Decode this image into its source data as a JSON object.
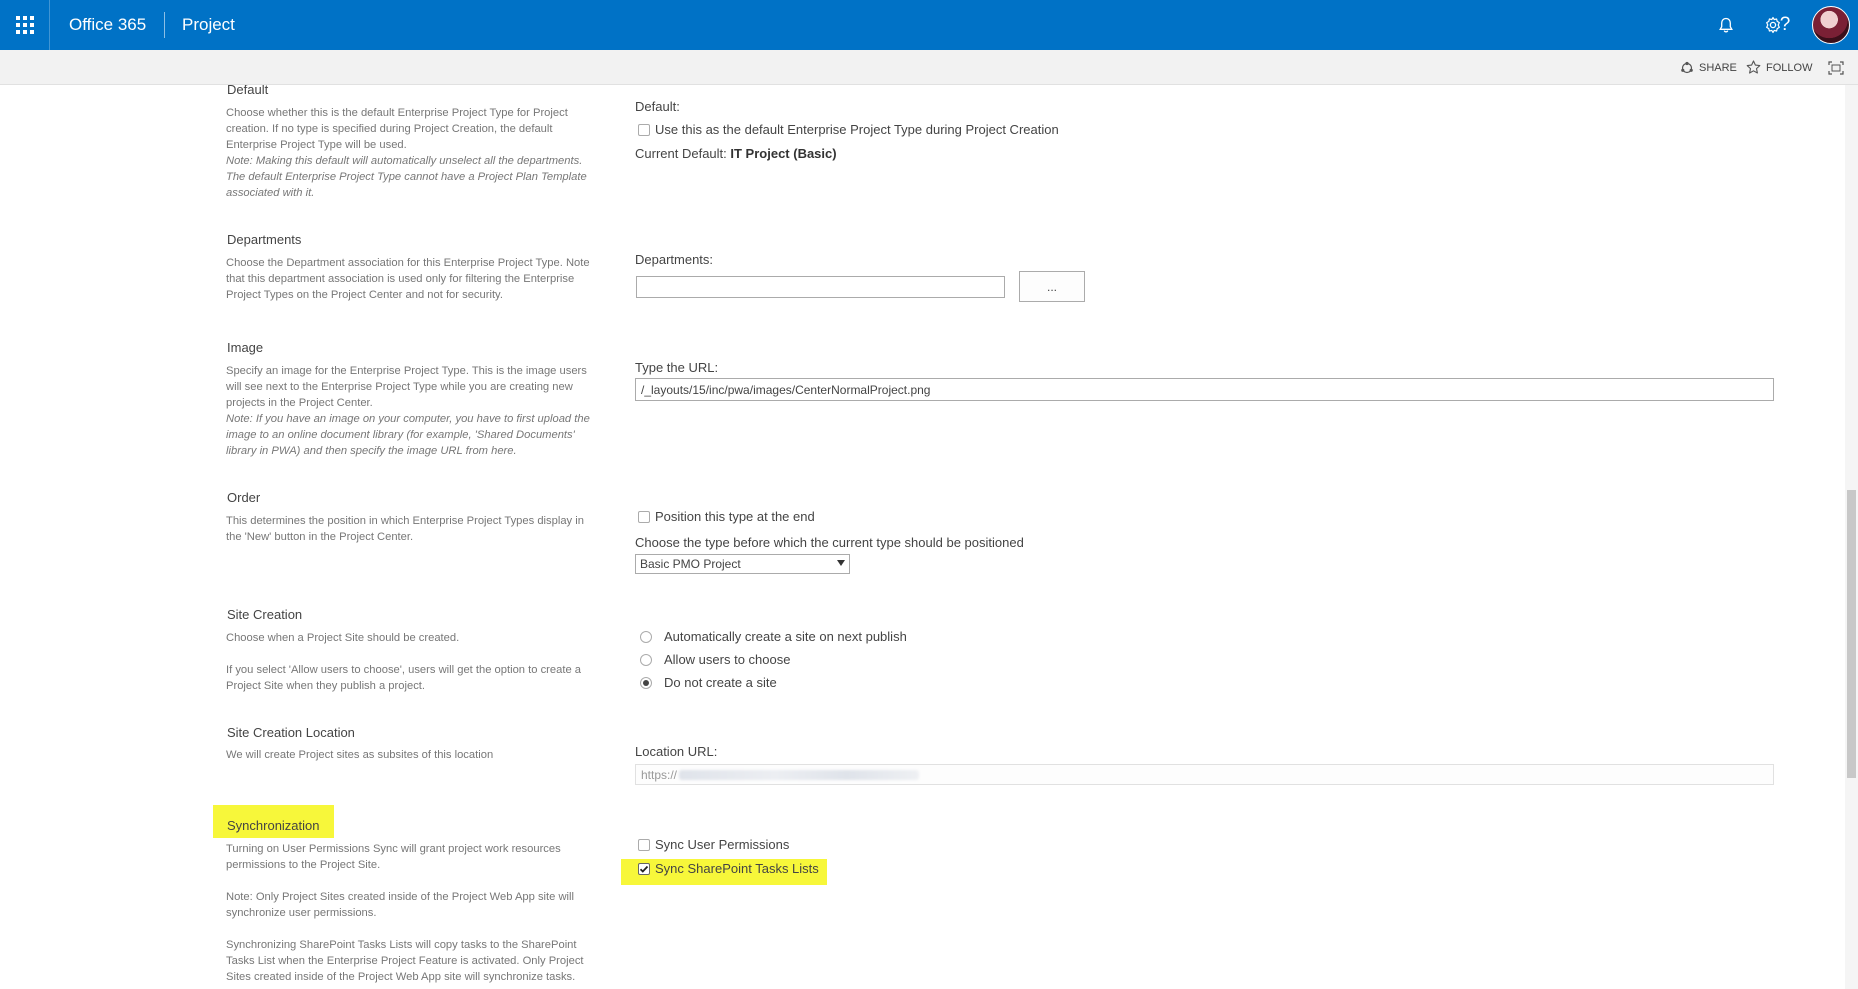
{
  "suite_bar": {
    "brand": "Office 365",
    "app_name": "Project"
  },
  "ribbon": {
    "share_label": "SHARE",
    "follow_label": "FOLLOW"
  },
  "colors": {
    "suite_bar": "#0072c6",
    "highlight": "#f7f73a"
  },
  "sections": {
    "default": {
      "title": "Default",
      "desc_1": "Choose whether this is the default Enterprise Project Type for Project creation. If no type is specified during Project Creation, the default Enterprise Project Type will be used.",
      "desc_note": "Note: Making this default will automatically unselect all the departments. The default Enterprise Project Type cannot have a Project Plan Template associated with it.",
      "field_label": "Default:",
      "checkbox_label": "Use this as the default Enterprise Project Type during Project Creation",
      "checkbox_checked": false,
      "current_default_label": "Current Default:",
      "current_default_value": "IT Project (Basic)"
    },
    "departments": {
      "title": "Departments",
      "desc": "Choose the Department association for this Enterprise Project Type. Note that this department association is used only for filtering the Enterprise Project Types on the Project Center and not for security.",
      "field_label": "Departments:",
      "input_value": "",
      "browse_label": "..."
    },
    "image": {
      "title": "Image",
      "desc_1": "Specify an image for the Enterprise Project Type. This is the image users will see next to the Enterprise Project Type while you are creating new projects in the Project Center.",
      "desc_note": "Note: If you have an image on your computer, you have to first upload the image to an online document library (for example, 'Shared Documents' library in PWA) and then specify the image URL from here.",
      "field_label": "Type the URL:",
      "url_value": "/_layouts/15/inc/pwa/images/CenterNormalProject.png"
    },
    "order": {
      "title": "Order",
      "desc": "This determines the position in which Enterprise Project Types display in the 'New' button in the Project Center.",
      "checkbox_label": "Position this type at the end",
      "checkbox_checked": false,
      "select_label": "Choose the type before which the current type should be positioned",
      "select_value": "Basic PMO Project"
    },
    "site_creation": {
      "title": "Site Creation",
      "desc_1": "Choose when a Project Site should be created.",
      "desc_2": "If you select 'Allow users to choose', users will get the option to create a Project Site when they publish a project.",
      "options": [
        {
          "label": "Automatically create a site on next publish",
          "selected": false
        },
        {
          "label": "Allow users to choose",
          "selected": false
        },
        {
          "label": "Do not create a site",
          "selected": true
        }
      ]
    },
    "site_location": {
      "title": "Site Creation Location",
      "desc": "We will create Project sites as subsites of this location",
      "field_label": "Location URL:",
      "url_prefix": "https://"
    },
    "sync": {
      "title": "Synchronization",
      "desc_1": "Turning on User Permissions Sync will grant project work resources permissions to the Project Site.",
      "desc_2": "Note: Only Project Sites created inside of the Project Web App site will synchronize user permissions.",
      "desc_3": "Synchronizing SharePoint Tasks Lists will copy tasks to the SharePoint Tasks List when the Enterprise Project Feature is activated. Only Project Sites created inside of the Project Web App site will synchronize tasks.",
      "user_perm_label": "Sync User Permissions",
      "user_perm_checked": false,
      "tasks_label": "Sync SharePoint Tasks Lists",
      "tasks_checked": true
    }
  }
}
